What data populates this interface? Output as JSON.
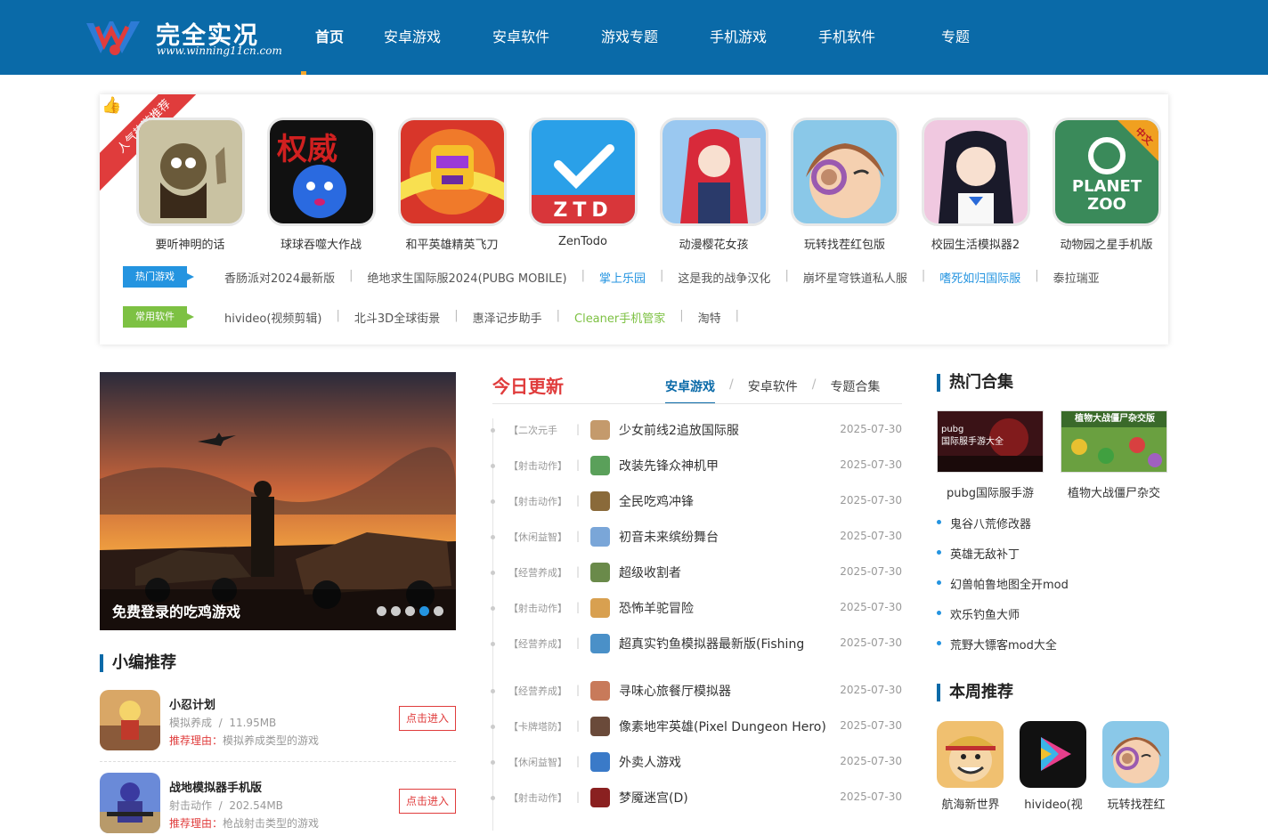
{
  "header": {
    "logo_title": "完全实况",
    "logo_url": "www.winning11cn.com",
    "nav": [
      "首页",
      "安卓游戏",
      "安卓软件",
      "游戏专题",
      "手机游戏",
      "手机软件",
      "专题"
    ],
    "active_nav": "首页"
  },
  "hot": {
    "ribbon": "人气热游推荐",
    "apps": [
      {
        "name": "要听神明的话",
        "icon": "old-man-art"
      },
      {
        "name": "球球吞噬大作战",
        "icon": "blue-ball-red-text"
      },
      {
        "name": "和平英雄精英飞刀",
        "icon": "yellow-robot"
      },
      {
        "name": "ZenTodo",
        "icon": "ztd-checkmark"
      },
      {
        "name": "动漫樱花女孩",
        "icon": "anime-red-hair-girl"
      },
      {
        "name": "玩转找茬红包版",
        "icon": "magnifier-girl"
      },
      {
        "name": "校园生活模拟器2",
        "icon": "anime-black-hair-girl"
      },
      {
        "name": "动物园之星手机版",
        "icon": "planet-zoo-logo"
      }
    ],
    "icon_texts": {
      "ztd": "ZTD",
      "quanwei": "权威",
      "planet": "PLANET",
      "zoo": "ZOO",
      "cn_badge": "中文"
    },
    "hot_games_tag": "热门游戏",
    "hot_games": [
      "香肠派对2024最新版",
      "绝地求生国际服2024(PUBG MOBILE)",
      "掌上乐园",
      "这是我的战争汉化",
      "崩坏星穹铁道私人服",
      "嗜死如归国际服",
      "泰拉瑞亚"
    ],
    "common_soft_tag": "常用软件",
    "common_soft": [
      "hivideo(视频剪辑)",
      "北斗3D全球街景",
      "惠泽记步助手",
      "Cleaner手机管家",
      "淘特"
    ],
    "separator": "|"
  },
  "slider": {
    "caption": "免费登录的吃鸡游戏",
    "dots": 5,
    "active_dot": 4
  },
  "picks": {
    "title": "小编推荐",
    "items": [
      {
        "name": "小忍计划",
        "category": "模拟养成",
        "size": "11.95MB",
        "reason_label": "推荐理由：",
        "reason": "模拟养成类型的游戏",
        "button": "点击进入"
      },
      {
        "name": "战地模拟器手机版",
        "category": "射击动作",
        "size": "202.54MB",
        "reason_label": "推荐理由：",
        "reason": "枪战射击类型的游戏",
        "button": "点击进入"
      }
    ],
    "meta_sep": "/"
  },
  "today": {
    "title": "今日更新",
    "tabs": [
      "安卓游戏",
      "安卓软件",
      "专题合集"
    ],
    "tab_sep": "/",
    "rows": [
      {
        "cat": "【二次元手",
        "title": "少女前线2追放国际服",
        "date": "2025-07-30",
        "color": "#c49a6c"
      },
      {
        "cat": "【射击动作】",
        "title": "改装先锋众神机甲",
        "date": "2025-07-30",
        "color": "#5aa05a"
      },
      {
        "cat": "【射击动作】",
        "title": "全民吃鸡冲锋",
        "date": "2025-07-30",
        "color": "#8a6a3a"
      },
      {
        "cat": "【休闲益智】",
        "title": "初音未来缤纷舞台",
        "date": "2025-07-30",
        "color": "#7aa6d8"
      },
      {
        "cat": "【经营养成】",
        "title": "超级收割者",
        "date": "2025-07-30",
        "color": "#6a8a4a"
      },
      {
        "cat": "【射击动作】",
        "title": "恐怖羊驼冒险",
        "date": "2025-07-30",
        "color": "#d8a050"
      },
      {
        "cat": "【经营养成】",
        "title": "超真实钓鱼模拟器最新版(Fishing",
        "date": "2025-07-30",
        "color": "#4a90c8"
      },
      {
        "cat": "【经营养成】",
        "title": "寻味心旅餐厅模拟器",
        "date": "2025-07-30",
        "color": "#c87a5a"
      },
      {
        "cat": "【卡牌塔防】",
        "title": "像素地牢英雄(Pixel Dungeon Hero)",
        "date": "2025-07-30",
        "color": "#6a4a3a"
      },
      {
        "cat": "【休闲益智】",
        "title": "外卖人游戏",
        "date": "2025-07-30",
        "color": "#3a7ac8"
      },
      {
        "cat": "【射击动作】",
        "title": "梦魇迷宫(D)",
        "date": "2025-07-30",
        "color": "#8a2020"
      }
    ]
  },
  "collections": {
    "title": "热门合集",
    "items": [
      {
        "name": "pubg国际服手游",
        "banner": "pubg\n国际服手游大全",
        "color": "#4a1a1a"
      },
      {
        "name": "植物大战僵尸杂交",
        "banner": "植物大战僵尸杂交版",
        "color": "#5a8a3a"
      }
    ],
    "list": [
      "鬼谷八荒修改器",
      "英雄无敌补丁",
      "幻兽帕鲁地图全开mod",
      "欢乐钓鱼大师",
      "荒野大镖客mod大全"
    ]
  },
  "weekly": {
    "title": "本周推荐",
    "items": [
      {
        "name": "航海新世界",
        "icon": "luffy"
      },
      {
        "name": "hivideo(视",
        "icon": "play-triangle"
      },
      {
        "name": "玩转找茬红",
        "icon": "magnifier-girl"
      }
    ]
  },
  "colors": {
    "header_bg": "#0a6aa8",
    "accent_red": "#e03c3c",
    "accent_blue": "#2494e0",
    "accent_green": "#7dc143",
    "nav_underline": "#f6a72b"
  }
}
